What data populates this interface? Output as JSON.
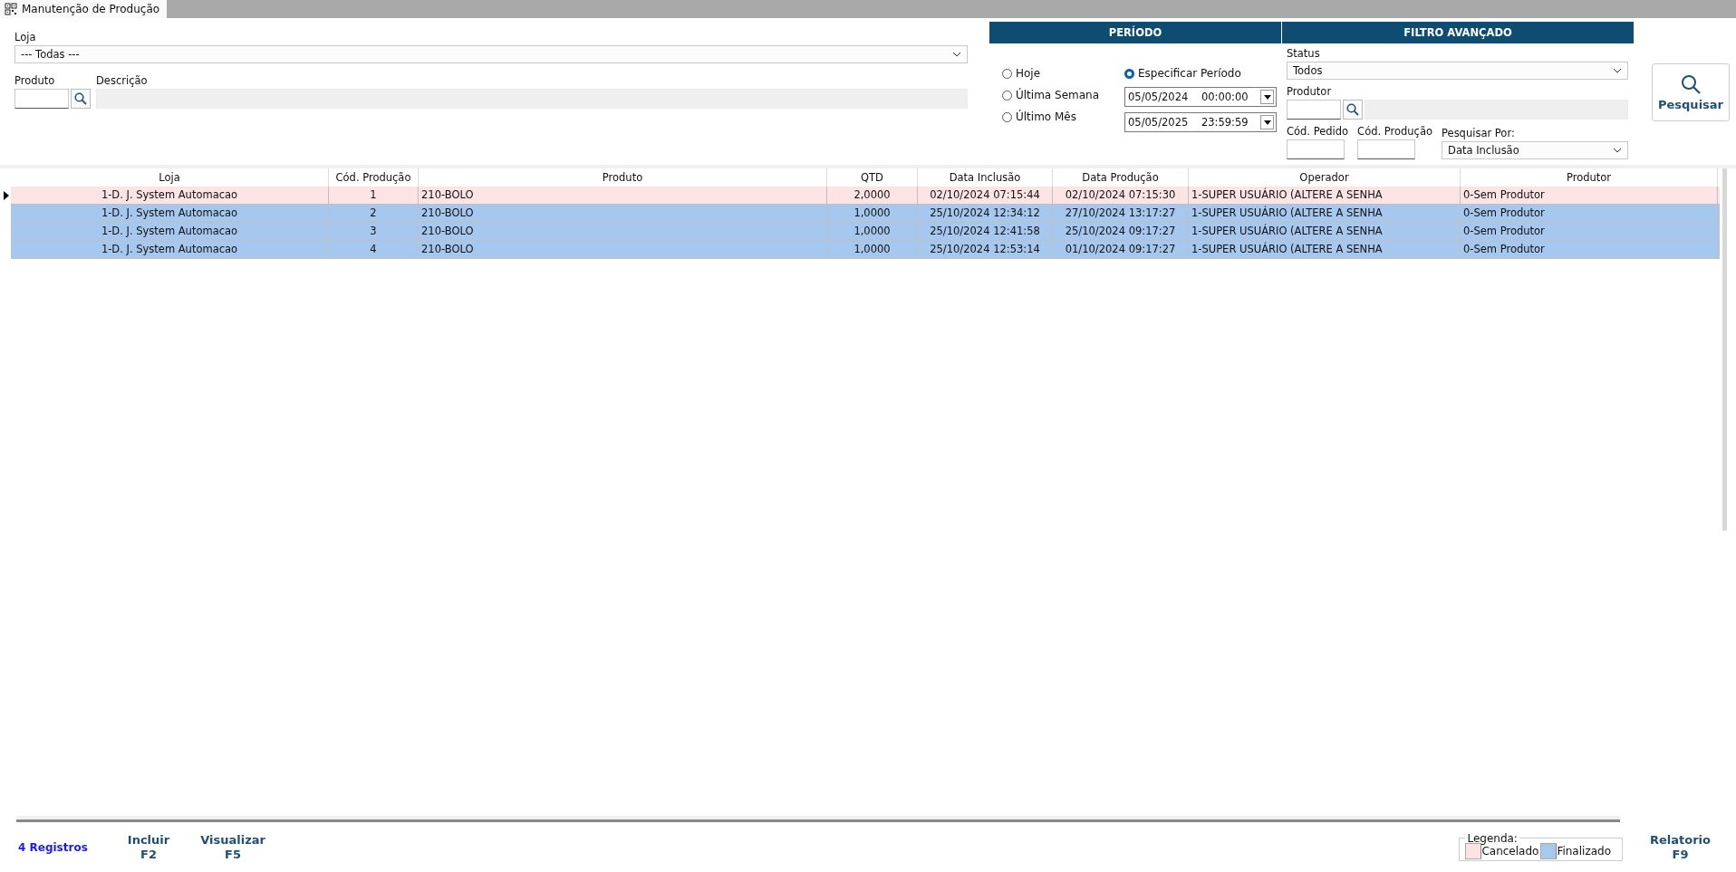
{
  "window": {
    "title": "Manutenção de Produção"
  },
  "filters": {
    "loja_label": "Loja",
    "loja_value": "--- Todas ---",
    "produto_label": "Produto",
    "descricao_label": "Descrição"
  },
  "periodo": {
    "title": "PERÍODO",
    "options": [
      {
        "label": "Hoje",
        "selected": false
      },
      {
        "label": "Última Semana",
        "selected": false
      },
      {
        "label": "Último Mês",
        "selected": false
      },
      {
        "label": "Especificar Período",
        "selected": true
      }
    ],
    "start": "05/05/2024    00:00:00",
    "end": "05/05/2025    23:59:59"
  },
  "filtro_avancado": {
    "title": "FILTRO AVANÇADO",
    "status_label": "Status",
    "status_value": "Todos",
    "produtor_label": "Produtor",
    "cod_pedido_label": "Cód. Pedido",
    "cod_producao_label": "Cód. Produção",
    "pesquisar_por_label": "Pesquisar Por:",
    "pesquisar_por_value": "Data Inclusão"
  },
  "search_button": "Pesquisar",
  "table": {
    "columns": [
      "Loja",
      "Cód. Produção",
      "Produto",
      "QTD",
      "Data Inclusão",
      "Data Produção",
      "Operador",
      "Produtor"
    ],
    "rows": [
      {
        "selected": true,
        "color": "#fde4e4",
        "cells": [
          "1-D. J. System Automacao",
          "1",
          "210-BOLO",
          "2,0000",
          "02/10/2024 07:15:44",
          "02/10/2024 07:15:30",
          "1-SUPER USUÁRIO (ALTERE A SENHA",
          "0-Sem Produtor"
        ]
      },
      {
        "selected": false,
        "color": "#a6c8ee",
        "cells": [
          "1-D. J. System Automacao",
          "2",
          "210-BOLO",
          "1,0000",
          "25/10/2024 12:34:12",
          "27/10/2024 13:17:27",
          "1-SUPER USUÁRIO (ALTERE A SENHA",
          "0-Sem Produtor"
        ]
      },
      {
        "selected": false,
        "color": "#a6c8ee",
        "cells": [
          "1-D. J. System Automacao",
          "3",
          "210-BOLO",
          "1,0000",
          "25/10/2024 12:41:58",
          "25/10/2024 09:17:27",
          "1-SUPER USUÁRIO (ALTERE A SENHA",
          "0-Sem Produtor"
        ]
      },
      {
        "selected": false,
        "color": "#a6c8ee",
        "cells": [
          "1-D. J. System Automacao",
          "4",
          "210-BOLO",
          "1,0000",
          "25/10/2024 12:53:14",
          "01/10/2024 09:17:27",
          "1-SUPER USUÁRIO (ALTERE A SENHA",
          "0-Sem Produtor"
        ]
      }
    ]
  },
  "footer": {
    "record_count": "4 Registros",
    "buttons": [
      {
        "label": "Incluir",
        "key": "F2"
      },
      {
        "label": "Visualizar",
        "key": "F5"
      }
    ],
    "legend": {
      "title": "Legenda:",
      "items": [
        {
          "label": "Cancelado",
          "color": "#fde4e4"
        },
        {
          "label": "Finalizado",
          "color": "#a6c8ee"
        }
      ]
    },
    "report_button": {
      "label": "Relatorio",
      "key": "F9"
    }
  }
}
